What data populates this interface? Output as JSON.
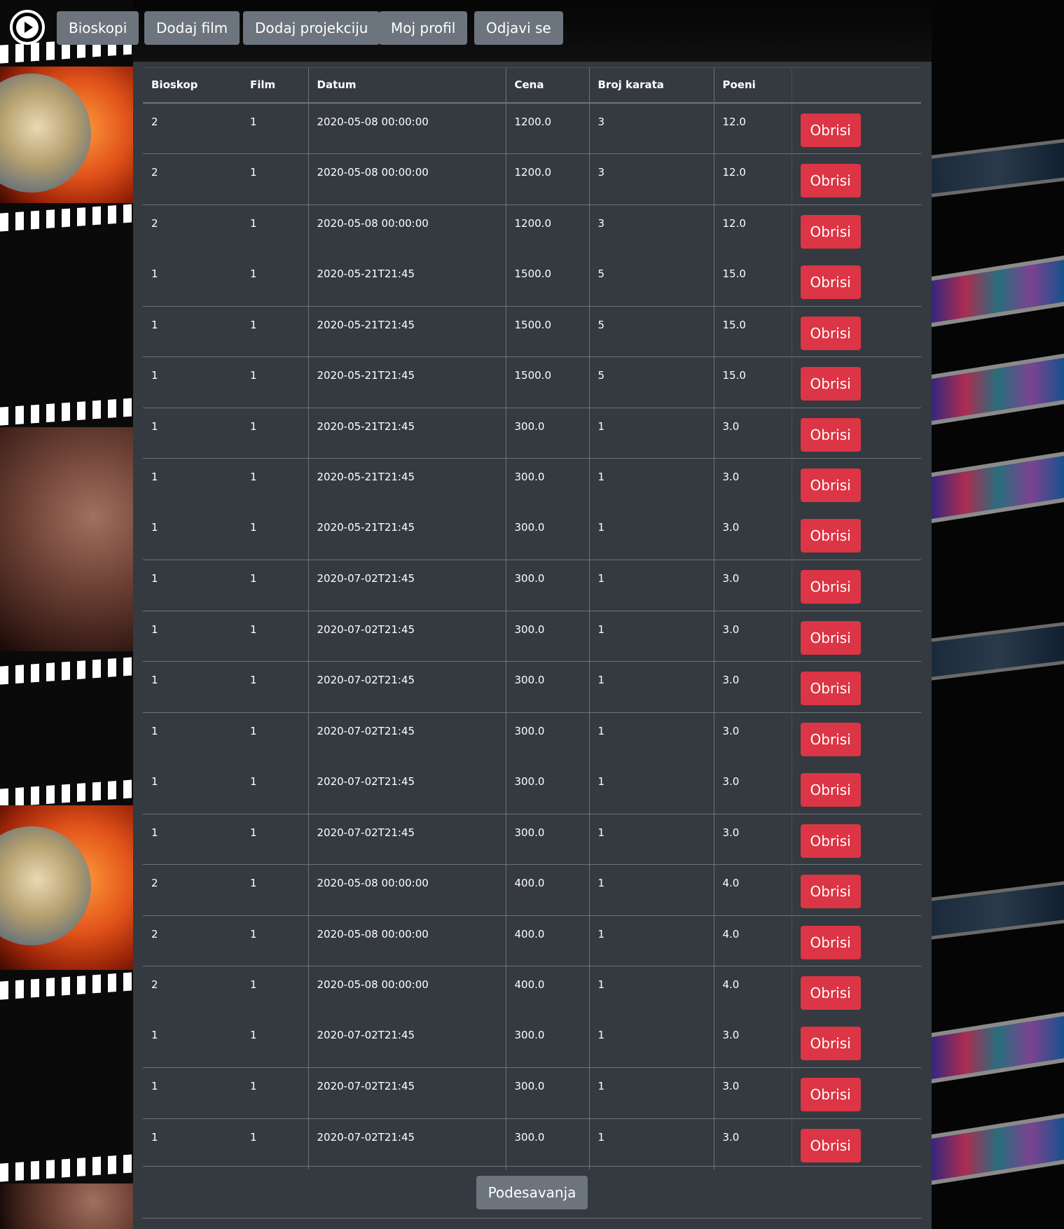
{
  "nav": {
    "logo_icon": "play-circle-icon",
    "items": [
      {
        "label": "Bioskopi"
      },
      {
        "label": "Dodaj film"
      },
      {
        "label": "Dodaj projekciju"
      },
      {
        "label": "Moj profil"
      },
      {
        "label": "Odjavi se"
      }
    ]
  },
  "table": {
    "headers": [
      "Bioskop",
      "Film",
      "Datum",
      "Cena",
      "Broj karata",
      "Poeni",
      ""
    ],
    "delete_label": "Obrisi",
    "rows": [
      {
        "bioskop": "2",
        "film": "1",
        "datum": "2020-05-08 00:00:00",
        "cena": "1200.0",
        "broj_karata": "3",
        "poeni": "12.0"
      },
      {
        "bioskop": "2",
        "film": "1",
        "datum": "2020-05-08 00:00:00",
        "cena": "1200.0",
        "broj_karata": "3",
        "poeni": "12.0"
      },
      {
        "bioskop": "2",
        "film": "1",
        "datum": "2020-05-08 00:00:00",
        "cena": "1200.0",
        "broj_karata": "3",
        "poeni": "12.0"
      },
      {
        "bioskop": "1",
        "film": "1",
        "datum": "2020-05-21T21:45",
        "cena": "1500.0",
        "broj_karata": "5",
        "poeni": "15.0"
      },
      {
        "bioskop": "1",
        "film": "1",
        "datum": "2020-05-21T21:45",
        "cena": "1500.0",
        "broj_karata": "5",
        "poeni": "15.0"
      },
      {
        "bioskop": "1",
        "film": "1",
        "datum": "2020-05-21T21:45",
        "cena": "1500.0",
        "broj_karata": "5",
        "poeni": "15.0"
      },
      {
        "bioskop": "1",
        "film": "1",
        "datum": "2020-05-21T21:45",
        "cena": "300.0",
        "broj_karata": "1",
        "poeni": "3.0"
      },
      {
        "bioskop": "1",
        "film": "1",
        "datum": "2020-05-21T21:45",
        "cena": "300.0",
        "broj_karata": "1",
        "poeni": "3.0"
      },
      {
        "bioskop": "1",
        "film": "1",
        "datum": "2020-05-21T21:45",
        "cena": "300.0",
        "broj_karata": "1",
        "poeni": "3.0"
      },
      {
        "bioskop": "1",
        "film": "1",
        "datum": "2020-07-02T21:45",
        "cena": "300.0",
        "broj_karata": "1",
        "poeni": "3.0"
      },
      {
        "bioskop": "1",
        "film": "1",
        "datum": "2020-07-02T21:45",
        "cena": "300.0",
        "broj_karata": "1",
        "poeni": "3.0"
      },
      {
        "bioskop": "1",
        "film": "1",
        "datum": "2020-07-02T21:45",
        "cena": "300.0",
        "broj_karata": "1",
        "poeni": "3.0"
      },
      {
        "bioskop": "1",
        "film": "1",
        "datum": "2020-07-02T21:45",
        "cena": "300.0",
        "broj_karata": "1",
        "poeni": "3.0"
      },
      {
        "bioskop": "1",
        "film": "1",
        "datum": "2020-07-02T21:45",
        "cena": "300.0",
        "broj_karata": "1",
        "poeni": "3.0"
      },
      {
        "bioskop": "1",
        "film": "1",
        "datum": "2020-07-02T21:45",
        "cena": "300.0",
        "broj_karata": "1",
        "poeni": "3.0"
      },
      {
        "bioskop": "2",
        "film": "1",
        "datum": "2020-05-08 00:00:00",
        "cena": "400.0",
        "broj_karata": "1",
        "poeni": "4.0"
      },
      {
        "bioskop": "2",
        "film": "1",
        "datum": "2020-05-08 00:00:00",
        "cena": "400.0",
        "broj_karata": "1",
        "poeni": "4.0"
      },
      {
        "bioskop": "2",
        "film": "1",
        "datum": "2020-05-08 00:00:00",
        "cena": "400.0",
        "broj_karata": "1",
        "poeni": "4.0"
      },
      {
        "bioskop": "1",
        "film": "1",
        "datum": "2020-07-02T21:45",
        "cena": "300.0",
        "broj_karata": "1",
        "poeni": "3.0"
      },
      {
        "bioskop": "1",
        "film": "1",
        "datum": "2020-07-02T21:45",
        "cena": "300.0",
        "broj_karata": "1",
        "poeni": "3.0"
      },
      {
        "bioskop": "1",
        "film": "1",
        "datum": "2020-07-02T21:45",
        "cena": "300.0",
        "broj_karata": "1",
        "poeni": "3.0"
      }
    ]
  },
  "footer": {
    "settings_label": "Podesavanja"
  },
  "colors": {
    "panel": "#343a40",
    "secondary_button": "#6c757d",
    "danger_button": "#dc3545",
    "text": "#ffffff"
  }
}
